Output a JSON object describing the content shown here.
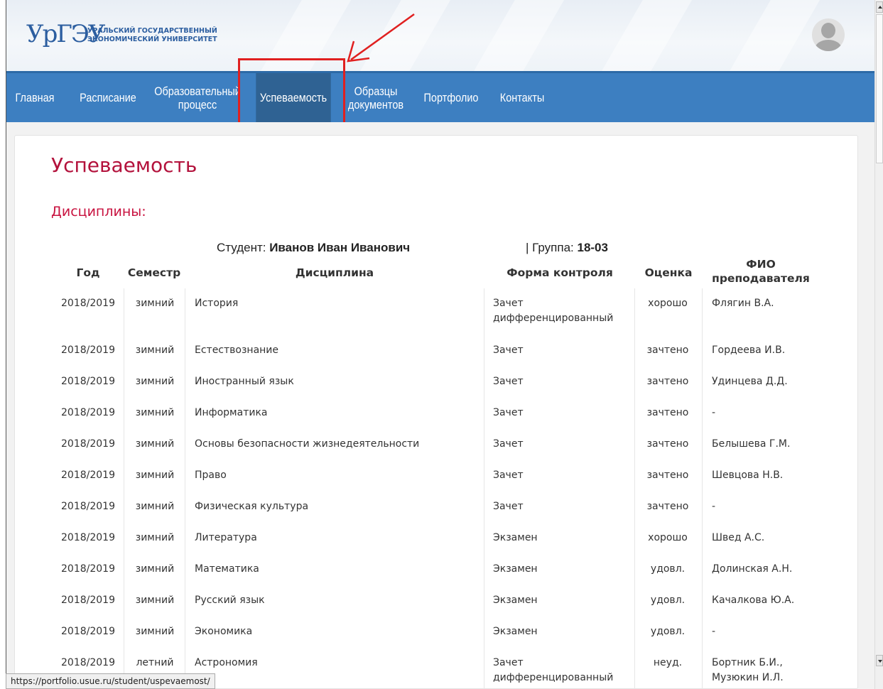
{
  "header": {
    "logo_mark": "УрГЭУ",
    "logo_line1": "УРАЛЬСКИЙ ГОСУДАРСТВЕННЫЙ",
    "logo_line2": "ЭКОНОМИЧЕСКИЙ УНИВЕРСИТЕТ",
    "avatar_icon": "user-avatar-icon"
  },
  "nav": {
    "items": [
      {
        "label": "Главная"
      },
      {
        "label": "Расписание"
      },
      {
        "label": "Образовательный процесс"
      },
      {
        "label": "Успеваемость",
        "active": true
      },
      {
        "label": "Образцы документов"
      },
      {
        "label": "Портфолио"
      },
      {
        "label": "Контакты"
      }
    ]
  },
  "page": {
    "title": "Успеваемость",
    "section": "Дисциплины:",
    "student_label": "Студент:",
    "student_name": "Иванов Иван Иванович",
    "group_label": "| Группа:",
    "group_value": "18-03"
  },
  "table": {
    "headers": [
      "Год",
      "Семестр",
      "Дисциплина",
      "Форма контроля",
      "Оценка",
      "ФИО преподавателя"
    ],
    "rows": [
      [
        "2018/2019",
        "зимний",
        "История",
        "Зачет дифференцированный",
        "хорошо",
        "Флягин В.А."
      ],
      [
        "2018/2019",
        "зимний",
        "Естествознание",
        "Зачет",
        "зачтено",
        "Гордеева И.В."
      ],
      [
        "2018/2019",
        "зимний",
        "Иностранный язык",
        "Зачет",
        "зачтено",
        "Удинцева Д.Д."
      ],
      [
        "2018/2019",
        "зимний",
        "Информатика",
        "Зачет",
        "зачтено",
        "-"
      ],
      [
        "2018/2019",
        "зимний",
        "Основы безопасности жизнедеятельности",
        "Зачет",
        "зачтено",
        "Белышева Г.М."
      ],
      [
        "2018/2019",
        "зимний",
        "Право",
        "Зачет",
        "зачтено",
        "Шевцова Н.В."
      ],
      [
        "2018/2019",
        "зимний",
        "Физическая культура",
        "Зачет",
        "зачтено",
        "-"
      ],
      [
        "2018/2019",
        "зимний",
        "Литература",
        "Экзамен",
        "хорошо",
        "Швед А.С."
      ],
      [
        "2018/2019",
        "зимний",
        "Математика",
        "Экзамен",
        "удовл.",
        "Долинская А.Н."
      ],
      [
        "2018/2019",
        "зимний",
        "Русский язык",
        "Экзамен",
        "удовл.",
        "Качалкова Ю.А."
      ],
      [
        "2018/2019",
        "зимний",
        "Экономика",
        "Экзамен",
        "удовл.",
        "-"
      ],
      [
        "2018/2019",
        "летний",
        "Астрономия",
        "Зачет дифференцированный",
        "неуд.",
        "Бортник Б.И., Музюкин И.Л."
      ]
    ]
  },
  "statusbar": {
    "url": "https://portfolio.usue.ru/student/uspevaemost/"
  },
  "colors": {
    "nav": "#3d7fc1",
    "nav_active": "#2f6293",
    "title": "#b3123c",
    "annotation": "#e02020"
  }
}
